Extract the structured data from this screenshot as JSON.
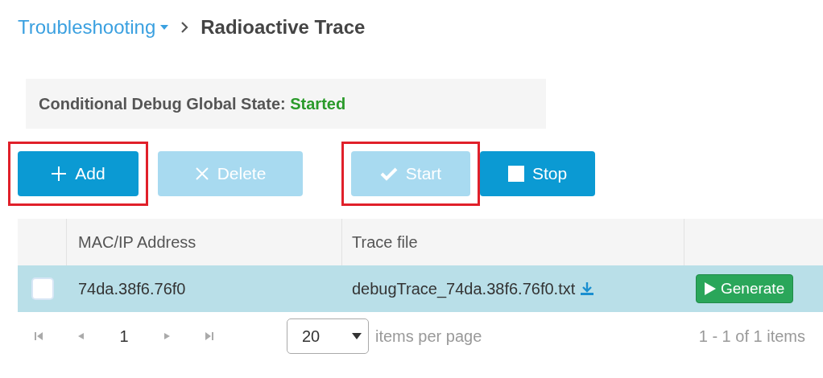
{
  "breadcrumb": {
    "parent": "Troubleshooting",
    "current": "Radioactive Trace"
  },
  "global_state": {
    "label": "Conditional Debug Global State:",
    "value": "Started"
  },
  "buttons": [
    {
      "kind": "add",
      "label": "Add",
      "disabled": false,
      "highlighted": true
    },
    {
      "kind": "delete",
      "label": "Delete",
      "disabled": true,
      "highlighted": false
    },
    {
      "kind": "start",
      "label": "Start",
      "disabled": true,
      "highlighted": true
    },
    {
      "kind": "stop",
      "label": "Stop",
      "disabled": false,
      "highlighted": false
    }
  ],
  "table": {
    "columns": [
      "MAC/IP Address",
      "Trace file"
    ],
    "rows": [
      {
        "selected": true,
        "checked": false,
        "address": "74da.38f6.76f0",
        "trace_file": "debugTrace_74da.38f6.76f0.txt",
        "action": "Generate"
      }
    ]
  },
  "pager": {
    "page": "1",
    "page_size": "20",
    "page_size_label": "items per page",
    "summary": "1 - 1 of 1 items"
  }
}
